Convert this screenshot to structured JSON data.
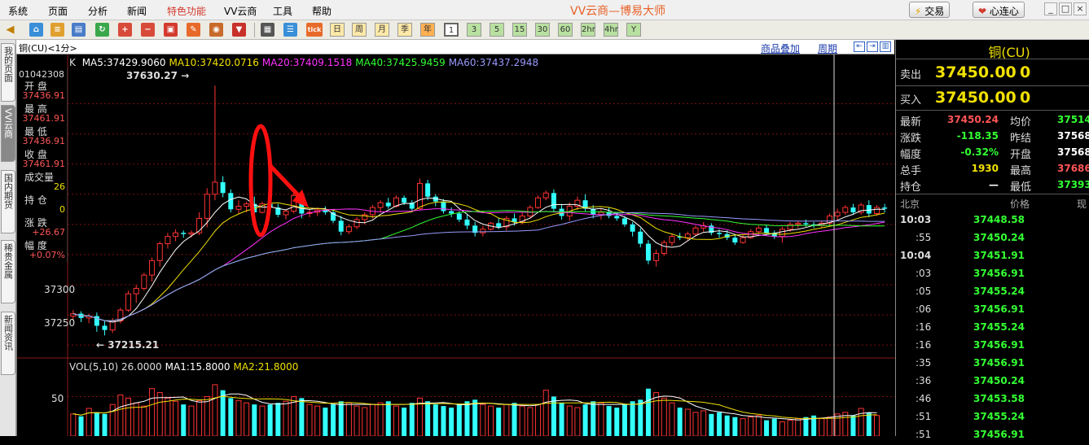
{
  "menu": {
    "items": [
      "系统",
      "页面",
      "分析",
      "新闻",
      "特色功能",
      "VV云商",
      "工具",
      "帮助"
    ],
    "highlight_color": "#d23b2e"
  },
  "app_title": "VV云商—博易大师",
  "top_buttons": {
    "trade": "交易",
    "xinlian": "心连心"
  },
  "window_controls": [
    "_",
    "□",
    "×"
  ],
  "toolbar": {
    "periods": [
      "日",
      "周",
      "月",
      "季",
      "年",
      "1",
      "3",
      "5",
      "15",
      "30",
      "60",
      "2hr",
      "4hr",
      "Y"
    ],
    "active_period": "1",
    "tick_label": "tick"
  },
  "sidebar": {
    "tabs": [
      "我的页面",
      "VV云商",
      "国内期货",
      "稀贵金属",
      "新闻资讯"
    ],
    "active_tab": "VV云商"
  },
  "chart_header": {
    "title": "铜(CU)<1分>",
    "overlay_link": "商品叠加",
    "period_link": "周期"
  },
  "ma_line": {
    "k": "K",
    "items": [
      {
        "label": "MA5:37429.9060",
        "color": "#ffffff"
      },
      {
        "label": "MA10:37420.0716",
        "color": "#f0e000"
      },
      {
        "label": "MA20:37409.1518",
        "color": "#ff33ff"
      },
      {
        "label": "MA40:37425.9459",
        "color": "#33ff33"
      },
      {
        "label": "MA60:37437.2948",
        "color": "#9999ff"
      }
    ]
  },
  "info_panel": {
    "date": "01042308",
    "rows": [
      {
        "label": "开 盘",
        "value": "37436.91",
        "color": "#ff5555"
      },
      {
        "label": "最 高",
        "value": "37461.91",
        "color": "#ff5555"
      },
      {
        "label": "最 低",
        "value": "37436.91",
        "color": "#ff5555"
      },
      {
        "label": "收 盘",
        "value": "37461.91",
        "color": "#ff5555"
      },
      {
        "label": "成交量",
        "value": "26",
        "color": "#f0e000"
      },
      {
        "label": "持 仓",
        "value": "0",
        "color": "#f0e000"
      },
      {
        "label": "涨 跌",
        "value": "+26.67",
        "color": "#ff5555"
      },
      {
        "label": "幅 度",
        "value": "+0.07%",
        "color": "#ff5555"
      }
    ]
  },
  "price_axis": {
    "labels": [
      "37300",
      "37250"
    ]
  },
  "price_annotations": {
    "high": "37630.27",
    "low": "37215.21"
  },
  "vol_line": {
    "items": [
      {
        "label": "VOL(5,10) 26.0000",
        "color": "#dddddd"
      },
      {
        "label": "MA1:15.8000",
        "color": "#ffffff"
      },
      {
        "label": "MA2:21.8000",
        "color": "#f0e000"
      }
    ]
  },
  "vol_axis": {
    "labels": [
      "50"
    ]
  },
  "quote": {
    "name": "铜(CU)",
    "sell": {
      "label": "卖出",
      "price": "37450.00",
      "qty": "0"
    },
    "buy": {
      "label": "买入",
      "price": "37450.00",
      "qty": "0"
    },
    "stats": [
      {
        "l1": "最新",
        "v1": "37450.24",
        "c1": "#ff5555",
        "l2": "均价",
        "v2": "37514",
        "c2": "#33ff33"
      },
      {
        "l1": "涨跌",
        "v1": "-118.35",
        "c1": "#33ff33",
        "l2": "昨结",
        "v2": "37568",
        "c2": "#ffffff"
      },
      {
        "l1": "幅度",
        "v1": "-0.32%",
        "c1": "#33ff33",
        "l2": "开盘",
        "v2": "37568",
        "c2": "#ffffff"
      },
      {
        "l1": "总手",
        "v1": "1930",
        "c1": "#f0e000",
        "l2": "最高",
        "v2": "37686",
        "c2": "#ff5555"
      },
      {
        "l1": "持仓",
        "v1": "—",
        "c1": "#ffffff",
        "l2": "最低",
        "v2": "37393",
        "c2": "#33ff33"
      }
    ],
    "ticks_header": {
      "place": "北京",
      "price": "价格",
      "vol": "现"
    },
    "ticks": [
      {
        "time": "10:03",
        "price": "37448.58",
        "bold": true
      },
      {
        "time": ":55",
        "price": "37450.24",
        "bold": false
      },
      {
        "time": "10:04",
        "price": "37451.91",
        "bold": true
      },
      {
        "time": ":03",
        "price": "37456.91",
        "bold": false
      },
      {
        "time": ":05",
        "price": "37455.24",
        "bold": false
      },
      {
        "time": ":06",
        "price": "37456.91",
        "bold": false
      },
      {
        "time": ":16",
        "price": "37455.24",
        "bold": false
      },
      {
        "time": ":16",
        "price": "37456.91",
        "bold": false
      },
      {
        "time": ":35",
        "price": "37456.91",
        "bold": false
      },
      {
        "time": ":36",
        "price": "37450.24",
        "bold": false
      },
      {
        "time": ":46",
        "price": "37453.58",
        "bold": false
      },
      {
        "time": ":51",
        "price": "37455.24",
        "bold": false
      },
      {
        "time": ":51",
        "price": "37456.91",
        "bold": false
      }
    ]
  },
  "chart_data": {
    "type": "candlestick",
    "title": "铜(CU)<1分>",
    "ylim": [
      37180,
      37660
    ],
    "series": [
      {
        "name": "K",
        "ohlc": [
          [
            37248,
            37258,
            37240,
            37252
          ],
          [
            37252,
            37256,
            37238,
            37245
          ],
          [
            37245,
            37252,
            37236,
            37248
          ],
          [
            37248,
            37254,
            37222,
            37232
          ],
          [
            37232,
            37240,
            37216,
            37225
          ],
          [
            37225,
            37245,
            37220,
            37240
          ],
          [
            37240,
            37262,
            37236,
            37258
          ],
          [
            37258,
            37290,
            37255,
            37285
          ],
          [
            37285,
            37300,
            37270,
            37294
          ],
          [
            37294,
            37320,
            37290,
            37316
          ],
          [
            37316,
            37345,
            37305,
            37340
          ],
          [
            37340,
            37372,
            37330,
            37368
          ],
          [
            37368,
            37386,
            37360,
            37380
          ],
          [
            37380,
            37392,
            37372,
            37386
          ],
          [
            37386,
            37390,
            37378,
            37384
          ],
          [
            37384,
            37390,
            37378,
            37386
          ],
          [
            37386,
            37420,
            37382,
            37410
          ],
          [
            37410,
            37460,
            37395,
            37450
          ],
          [
            37450,
            37630,
            37440,
            37470
          ],
          [
            37470,
            37480,
            37445,
            37452
          ],
          [
            37452,
            37458,
            37420,
            37425
          ],
          [
            37425,
            37440,
            37418,
            37430
          ],
          [
            37430,
            37438,
            37420,
            37434
          ],
          [
            37434,
            37446,
            37410,
            37420
          ],
          [
            37420,
            37438,
            37418,
            37434
          ],
          [
            37434,
            37440,
            37426,
            37428
          ],
          [
            37428,
            37434,
            37412,
            37416
          ],
          [
            37416,
            37425,
            37408,
            37422
          ],
          [
            37422,
            37452,
            37418,
            37448
          ],
          [
            37448,
            37456,
            37410,
            37418
          ],
          [
            37418,
            37426,
            37412,
            37420
          ],
          [
            37420,
            37428,
            37414,
            37424
          ],
          [
            37424,
            37430,
            37416,
            37420
          ],
          [
            37420,
            37424,
            37402,
            37406
          ],
          [
            37406,
            37414,
            37382,
            37388
          ],
          [
            37388,
            37400,
            37384,
            37396
          ],
          [
            37396,
            37412,
            37392,
            37408
          ],
          [
            37408,
            37420,
            37400,
            37416
          ],
          [
            37416,
            37432,
            37410,
            37428
          ],
          [
            37428,
            37440,
            37420,
            37436
          ],
          [
            37436,
            37444,
            37426,
            37430
          ],
          [
            37430,
            37448,
            37428,
            37444
          ],
          [
            37444,
            37448,
            37432,
            37436
          ],
          [
            37436,
            37440,
            37422,
            37426
          ],
          [
            37426,
            37476,
            37424,
            37468
          ],
          [
            37468,
            37474,
            37440,
            37446
          ],
          [
            37446,
            37450,
            37430,
            37438
          ],
          [
            37438,
            37442,
            37418,
            37422
          ],
          [
            37422,
            37428,
            37412,
            37418
          ],
          [
            37418,
            37422,
            37404,
            37408
          ],
          [
            37408,
            37416,
            37392,
            37398
          ],
          [
            37398,
            37404,
            37380,
            37386
          ],
          [
            37386,
            37398,
            37380,
            37392
          ],
          [
            37392,
            37404,
            37390,
            37402
          ],
          [
            37402,
            37410,
            37392,
            37396
          ],
          [
            37396,
            37414,
            37390,
            37410
          ],
          [
            37410,
            37418,
            37398,
            37404
          ],
          [
            37404,
            37420,
            37400,
            37414
          ],
          [
            37414,
            37432,
            37410,
            37428
          ],
          [
            37428,
            37448,
            37426,
            37444
          ],
          [
            37444,
            37456,
            37440,
            37452
          ],
          [
            37452,
            37458,
            37420,
            37426
          ],
          [
            37426,
            37434,
            37408,
            37414
          ],
          [
            37414,
            37436,
            37406,
            37430
          ],
          [
            37430,
            37446,
            37424,
            37440
          ],
          [
            37440,
            37450,
            37422,
            37426
          ],
          [
            37426,
            37432,
            37410,
            37416
          ],
          [
            37416,
            37426,
            37408,
            37420
          ],
          [
            37420,
            37428,
            37410,
            37414
          ],
          [
            37414,
            37420,
            37406,
            37410
          ],
          [
            37410,
            37414,
            37396,
            37400
          ],
          [
            37400,
            37404,
            37380,
            37388
          ],
          [
            37388,
            37394,
            37362,
            37368
          ],
          [
            37368,
            37374,
            37334,
            37340
          ],
          [
            37340,
            37358,
            37330,
            37352
          ],
          [
            37352,
            37374,
            37348,
            37370
          ],
          [
            37370,
            37384,
            37364,
            37380
          ],
          [
            37380,
            37386,
            37374,
            37378
          ],
          [
            37378,
            37388,
            37372,
            37384
          ],
          [
            37384,
            37398,
            37380,
            37394
          ],
          [
            37394,
            37404,
            37388,
            37398
          ],
          [
            37398,
            37402,
            37382,
            37386
          ],
          [
            37386,
            37392,
            37378,
            37384
          ],
          [
            37384,
            37390,
            37374,
            37378
          ],
          [
            37378,
            37384,
            37366,
            37370
          ],
          [
            37370,
            37382,
            37368,
            37378
          ],
          [
            37378,
            37392,
            37376,
            37388
          ],
          [
            37388,
            37398,
            37384,
            37394
          ],
          [
            37394,
            37400,
            37384,
            37386
          ],
          [
            37386,
            37390,
            37376,
            37380
          ],
          [
            37380,
            37396,
            37370,
            37392
          ],
          [
            37392,
            37404,
            37388,
            37400
          ],
          [
            37400,
            37406,
            37394,
            37402
          ],
          [
            37402,
            37408,
            37396,
            37400
          ],
          [
            37400,
            37404,
            37394,
            37398
          ],
          [
            37398,
            37406,
            37394,
            37402
          ],
          [
            37402,
            37418,
            37398,
            37414
          ],
          [
            37414,
            37426,
            37408,
            37420
          ],
          [
            37420,
            37432,
            37416,
            37428
          ],
          [
            37428,
            37434,
            37416,
            37420
          ],
          [
            37420,
            37436,
            37416,
            37432
          ],
          [
            37432,
            37440,
            37412,
            37418
          ],
          [
            37418,
            37432,
            37414,
            37428
          ],
          [
            37428,
            37434,
            37420,
            37426
          ]
        ]
      },
      {
        "name": "VOL",
        "values": [
          28,
          25,
          35,
          30,
          28,
          40,
          52,
          48,
          42,
          38,
          60,
          55,
          48,
          44,
          40,
          38,
          45,
          50,
          65,
          58,
          48,
          45,
          42,
          40,
          38,
          40,
          42,
          44,
          50,
          48,
          40,
          38,
          36,
          40,
          44,
          42,
          38,
          36,
          40,
          42,
          44,
          38,
          36,
          42,
          48,
          44,
          40,
          38,
          36,
          40,
          44,
          46,
          40,
          38,
          36,
          40,
          42,
          38,
          36,
          40,
          58,
          50,
          42,
          38,
          36,
          40,
          44,
          42,
          38,
          36,
          40,
          44,
          46,
          60,
          55,
          48,
          42,
          36,
          34,
          30,
          32,
          28,
          30,
          26,
          24,
          22,
          24,
          26,
          20,
          22,
          18,
          20,
          22,
          24,
          26,
          22,
          24,
          28,
          30,
          26,
          35,
          30,
          26
        ]
      }
    ]
  }
}
